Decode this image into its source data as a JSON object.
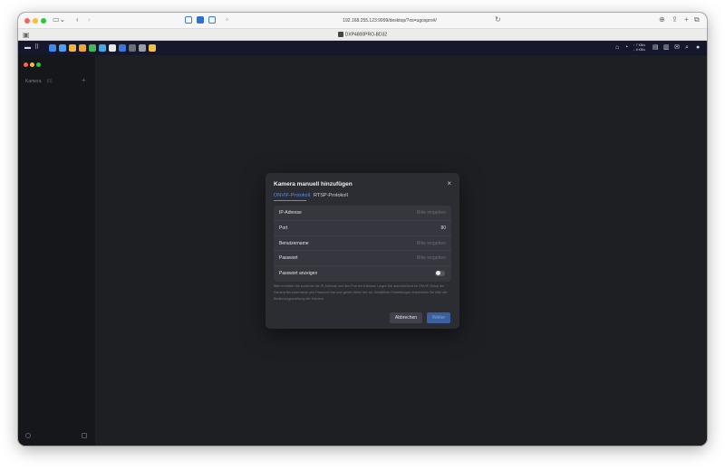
{
  "browser": {
    "url": "192.168.255.123:9999/desktop/?os=ugospro#/",
    "tab_title": "DXP4800PRO-BD32"
  },
  "taskbar": {
    "network_up": "↑ 7 KB/s",
    "network_down": "↓ 6 KB/s",
    "notification_count": "1"
  },
  "sidebar": {
    "title": "Kamera",
    "count": "(0)",
    "add_label": "+"
  },
  "dialog": {
    "title": "Kamera manuell hinzufügen",
    "close_label": "×",
    "tabs": [
      {
        "label": "ONVIF-Protokoll",
        "active": true
      },
      {
        "label": "RTSP-Protokoll",
        "active": false
      }
    ],
    "fields": {
      "ip": {
        "label": "IP-Adresse",
        "placeholder": "Bitte eingeben",
        "value": ""
      },
      "port": {
        "label": "Port",
        "placeholder": "",
        "value": "80"
      },
      "username": {
        "label": "Benutzername",
        "placeholder": "Bitte eingeben",
        "value": ""
      },
      "password": {
        "label": "Passwort",
        "placeholder": "Bitte eingeben",
        "value": ""
      },
      "show_password": {
        "label": "Passwort anzeigen",
        "enabled": false
      }
    },
    "hint": "Bitte ermitteln Sie zunächst die IP-Adresse und den Port der Kamera. Legen Sie anschließend im ONVIF-Setup der Kamera Benutzername und Passwort fest und geben diese hier an. Detaillierte Einstellungen entnehmen Sie bitte der Bedienungsanleitung der Kamera.",
    "buttons": {
      "cancel": "Abbrechen",
      "next": "Weiter"
    }
  },
  "colors": {
    "accent": "#4e8cf6",
    "dialog_bg": "#2c2d33",
    "desktop_bg": "#1e1f23",
    "taskbar_bg": "#15182a"
  }
}
